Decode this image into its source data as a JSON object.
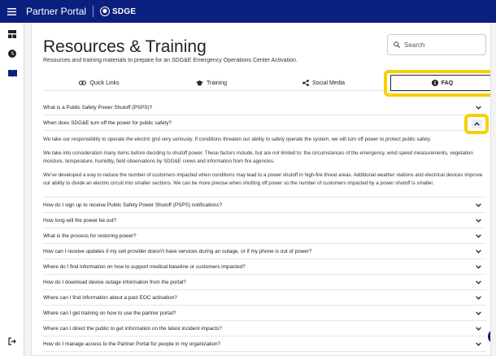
{
  "topbar": {
    "app_title": "Partner Portal",
    "brand": "SDGE"
  },
  "page": {
    "title": "Resources & Training",
    "subtitle": "Resources and training materials to prepare for an SDG&E Emergency Operations Center Activation."
  },
  "search": {
    "placeholder": "Search"
  },
  "tabs": [
    {
      "label": "Quick Links",
      "icon": "link-icon"
    },
    {
      "label": "Training",
      "icon": "graduation-cap-icon"
    },
    {
      "label": "Social Media",
      "icon": "share-icon"
    },
    {
      "label": "FAQ",
      "icon": "info-icon",
      "active": true
    }
  ],
  "faq": {
    "q0": "What is a Public Safety Power Shutoff (PSPS)?",
    "open_question": "When does SDG&E turn off the power for public safety?",
    "answer_paragraphs": [
      "We take our responsibility to operate the electric grid very seriously. If conditions threaten our ability to safely operate the system, we will turn off power to protect public safety.",
      "We take into consideration many items before deciding to shutoff power. These factors include, but are not limited to: the circumstances of the emergency, wind speed measurements, vegetation moisture, temperature, humidity, field observations by SDG&E crews and information from fire agencies.",
      "We've developed a way to reduce the number of customers impacted when conditions may lead to a power shutoff in high-fire threat areas. Additional weather stations and electrical devices improve our ability to divide an electric circuit into smaller sections. We can be more precise when shutting off power so the number of customers impacted by a power shutoff is smaller."
    ],
    "questions": [
      "How do I sign up to receive Public Safety Power Shutoff (PSPS) notifications?",
      "How long will the power be out?",
      "What is the process for restoring power?",
      "How can I receive updates if my cell provider doesn't have services during an outage, or if my phone is out of power?",
      "Where do I find information on how to support medical baseline or customers impacted?",
      "How do I download device outage information from the portal?",
      "Where can I find information about a past EOC activation?",
      "Where can I get training on how to use the partner portal?",
      "Where can I direct the public to get information on the latest incident impacts?",
      "How do I manage access to the Partner Portal for people in my organization?"
    ]
  },
  "help": {
    "label": "?"
  },
  "colors": {
    "topbar": "#0b1f7e",
    "highlight": "#f7d000"
  }
}
